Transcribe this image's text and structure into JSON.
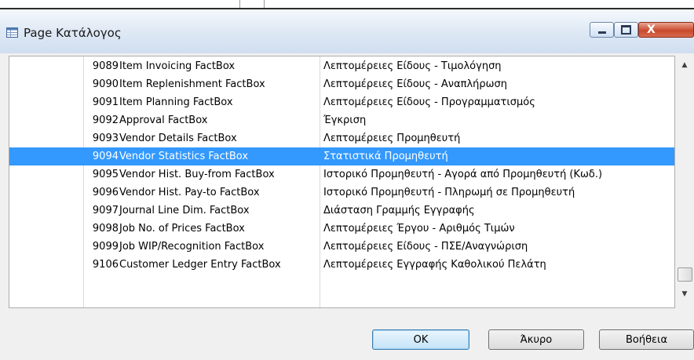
{
  "window": {
    "title": "Page Κατάλογος",
    "icon": "table-icon",
    "close_glyph": "X"
  },
  "list": {
    "selected_index": 5,
    "rows": [
      {
        "id": "9089",
        "name": "Item Invoicing FactBox",
        "caption": "Λεπτομέρειες Είδους - Τιμολόγηση"
      },
      {
        "id": "9090",
        "name": "Item Replenishment FactBox",
        "caption": "Λεπτομέρειες Είδους - Αναπλήρωση"
      },
      {
        "id": "9091",
        "name": "Item Planning FactBox",
        "caption": "Λεπτομέρειες Είδους - Προγραμματισμός"
      },
      {
        "id": "9092",
        "name": "Approval FactBox",
        "caption": "Έγκριση"
      },
      {
        "id": "9093",
        "name": "Vendor Details FactBox",
        "caption": "Λεπτομέρειες Προμηθευτή"
      },
      {
        "id": "9094",
        "name": "Vendor Statistics FactBox",
        "caption": "Στατιστικά Προμηθευτή"
      },
      {
        "id": "9095",
        "name": "Vendor Hist. Buy-from FactBox",
        "caption": "Ιστορικό Προμηθευτή - Αγορά από Προμηθευτή (Κωδ.)"
      },
      {
        "id": "9096",
        "name": "Vendor Hist. Pay-to FactBox",
        "caption": "Ιστορικό Προμηθευτή - Πληρωμή σε Προμηθευτή"
      },
      {
        "id": "9097",
        "name": "Journal Line Dim. FactBox",
        "caption": "Διάσταση Γραμμής Εγγραφής"
      },
      {
        "id": "9098",
        "name": "Job No. of Prices FactBox",
        "caption": "Λεπτομέρειες Έργου - Αριθμός Τιμών"
      },
      {
        "id": "9099",
        "name": "Job WIP/Recognition FactBox",
        "caption": "Λεπτομέρειες Είδους - ΠΣΕ/Αναγνώριση"
      },
      {
        "id": "9106",
        "name": "Customer Ledger Entry FactBox",
        "caption": "Λεπτομέρειες Εγγραφής Καθολικού Πελάτη"
      }
    ]
  },
  "scrollbar": {
    "up_glyph": "▲",
    "down_glyph": "▼"
  },
  "buttons": {
    "ok": "OK",
    "cancel": "Άκυρο",
    "help": "Βοήθεια"
  },
  "colors": {
    "selection": "#3399ff",
    "title_gradient_top": "#f4f8fc",
    "close_button": "#c94a2d"
  }
}
